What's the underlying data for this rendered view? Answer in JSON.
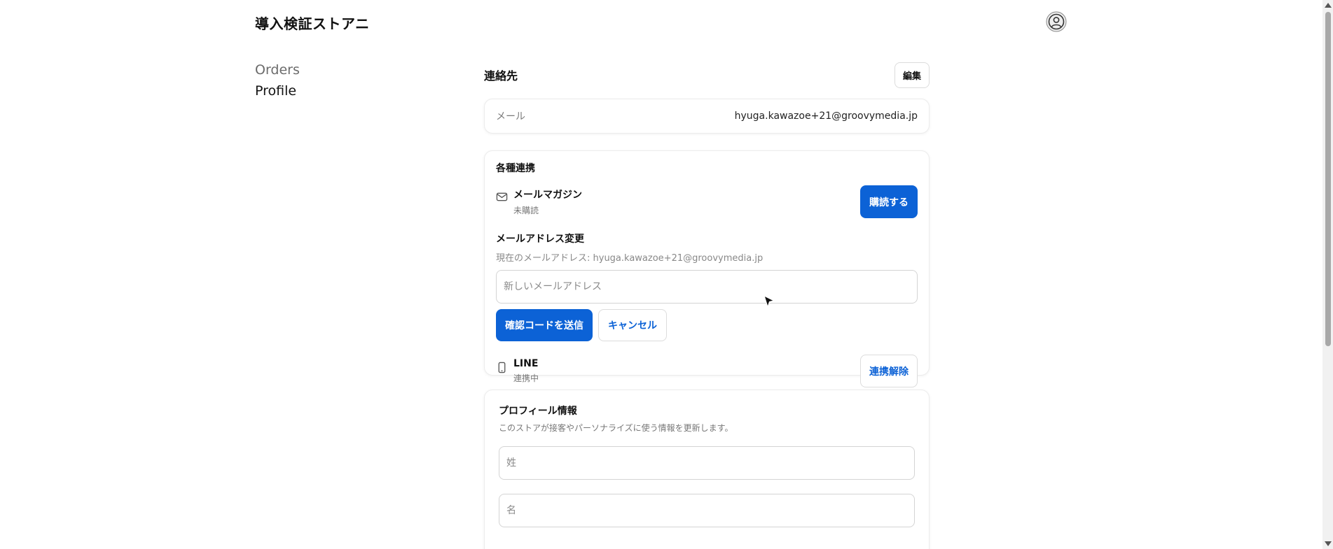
{
  "header": {
    "store_title": "導入検証ストアニ",
    "avatar_icon": "user-circle-icon"
  },
  "nav": {
    "items": [
      {
        "label": "Orders",
        "active": false
      },
      {
        "label": "Profile",
        "active": true
      }
    ]
  },
  "contact": {
    "title": "連絡先",
    "edit_label": "編集",
    "email_label": "メール",
    "email_value": "hyuga.kawazoe+21@groovymedia.jp"
  },
  "links": {
    "title": "各種連携",
    "newsletter": {
      "icon": "mail-icon",
      "title": "メールマガジン",
      "status": "未購読",
      "button_label": "購読する"
    },
    "email_change": {
      "title": "メールアドレス変更",
      "current": "現在のメールアドレス: hyuga.kawazoe+21@groovymedia.jp",
      "placeholder": "新しいメールアドレス",
      "send_label": "確認コードを送信",
      "cancel_label": "キャンセル"
    },
    "line": {
      "icon": "smartphone-icon",
      "title": "LINE",
      "status": "連携中",
      "button_label": "連携解除"
    }
  },
  "profile": {
    "title": "プロフィール情報",
    "description": "このストアが接客やパーソナライズに使う情報を更新します。",
    "last_name_placeholder": "姓",
    "first_name_placeholder": "名"
  },
  "colors": {
    "primary": "#0c62d6",
    "muted_text": "#777777",
    "border": "#d4d4d4"
  }
}
